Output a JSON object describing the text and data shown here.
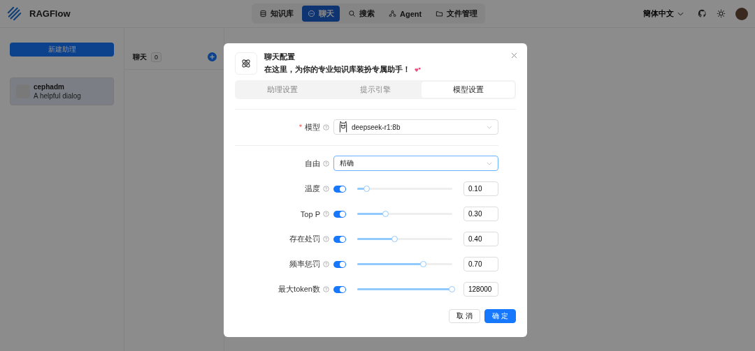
{
  "app": {
    "name": "RAGFlow"
  },
  "nav": [
    {
      "label": "知识库",
      "selected": false
    },
    {
      "label": "聊天",
      "selected": true
    },
    {
      "label": "搜索",
      "selected": false
    },
    {
      "label": "Agent",
      "selected": false
    },
    {
      "label": "文件管理",
      "selected": false
    }
  ],
  "language": "簡体中文",
  "sidebar": {
    "new_button": "新建助理",
    "assistants": [
      {
        "name": "cephadm",
        "description": "A helpful dialog",
        "selected": true
      }
    ]
  },
  "chat_list": {
    "title": "聊天",
    "count": "0"
  },
  "dialog": {
    "title": "聊天配置",
    "subtitle": "在这里，为你的专业知识库装扮专属助手！",
    "tabs": [
      {
        "label": "助理设置",
        "selected": false
      },
      {
        "label": "提示引擎",
        "selected": false
      },
      {
        "label": "模型设置",
        "selected": true
      }
    ],
    "model": {
      "label": "模型",
      "required_mark": "*",
      "value": "deepseek-r1:8b"
    },
    "freedom": {
      "label": "自由",
      "value": "精确"
    },
    "params": [
      {
        "label": "温度",
        "on": true,
        "level": 0.1,
        "value": "0.10"
      },
      {
        "label": "Top P",
        "on": true,
        "level": 0.3,
        "value": "0.30"
      },
      {
        "label": "存在处罚",
        "on": true,
        "level": 0.4,
        "value": "0.40"
      },
      {
        "label": "频率惩罚",
        "on": true,
        "level": 0.7,
        "value": "0.70"
      },
      {
        "label": "最大token数",
        "on": true,
        "level": 1,
        "value": "128000"
      }
    ],
    "cancel": "取 消",
    "ok": "确 定"
  }
}
